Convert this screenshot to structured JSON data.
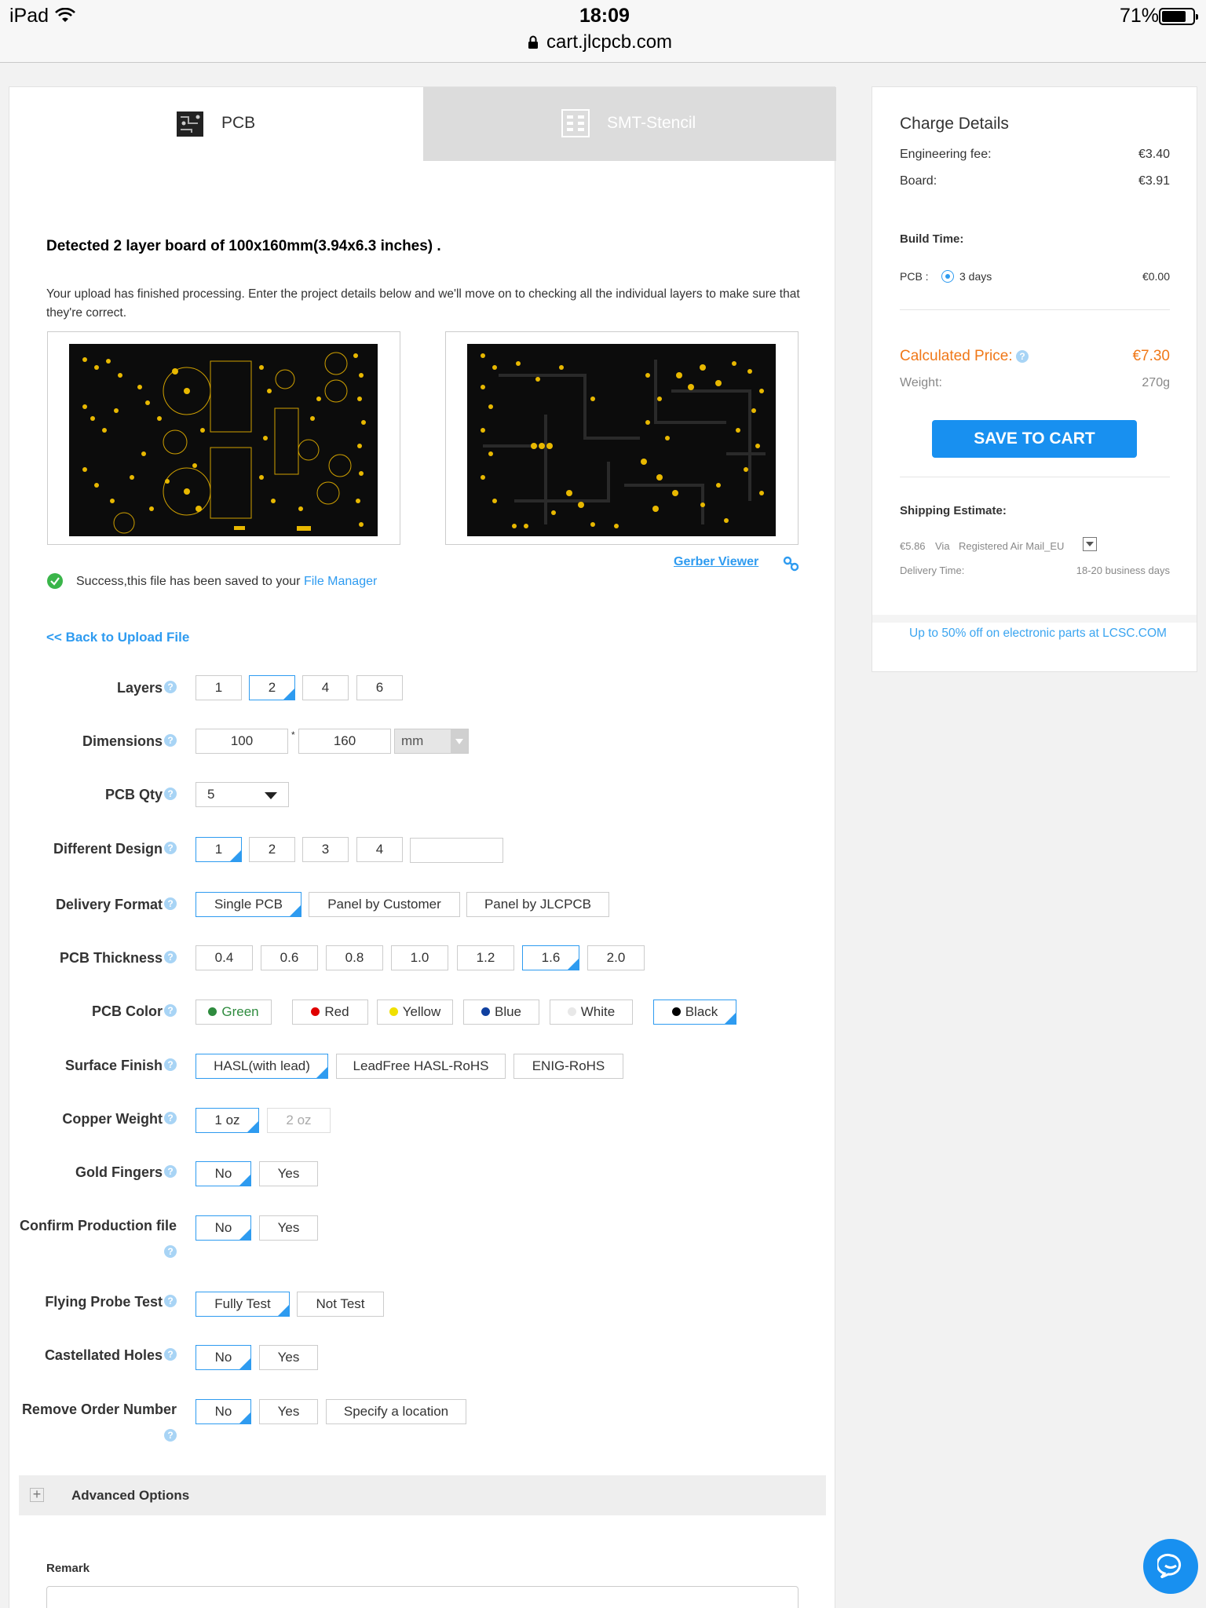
{
  "status": {
    "device": "iPad",
    "time": "18:09",
    "battery": "71%",
    "url": "cart.jlcpcb.com"
  },
  "tabs": [
    {
      "label": "PCB"
    },
    {
      "label": "SMT-Stencil"
    }
  ],
  "detect_title": "Detected 2 layer board of 100x160mm(3.94x6.3 inches) .",
  "detect_text": "Your upload has finished processing. Enter the project details below and we'll move on to checking all the individual layers to make sure that they're correct.",
  "gerber_viewer": "Gerber Viewer",
  "success_text": "Success,this file has been saved to your",
  "file_manager": "File Manager",
  "back_link": "<< Back to Upload File",
  "form": {
    "layers": {
      "label": "Layers",
      "options": [
        "1",
        "2",
        "4",
        "6"
      ],
      "selected": "2"
    },
    "dimensions": {
      "label": "Dimensions",
      "width": "100",
      "sep": "*",
      "height": "160",
      "unit": "mm"
    },
    "qty": {
      "label": "PCB Qty",
      "value": "5"
    },
    "design": {
      "label": "Different Design",
      "options": [
        "1",
        "2",
        "3",
        "4"
      ],
      "selected": "1"
    },
    "delivery": {
      "label": "Delivery Format",
      "options": [
        "Single PCB",
        "Panel by Customer",
        "Panel by JLCPCB"
      ],
      "selected": "Single PCB"
    },
    "thickness": {
      "label": "PCB Thickness",
      "options": [
        "0.4",
        "0.6",
        "0.8",
        "1.0",
        "1.2",
        "1.6",
        "2.0"
      ],
      "selected": "1.6"
    },
    "color": {
      "label": "PCB Color",
      "options": [
        {
          "name": "Green",
          "color": "#2e8b3e"
        },
        {
          "name": "Red",
          "color": "#e00000"
        },
        {
          "name": "Yellow",
          "color": "#f0e000"
        },
        {
          "name": "Blue",
          "color": "#1040a0"
        },
        {
          "name": "White",
          "color": "#e8e8e8"
        },
        {
          "name": "Black",
          "color": "#000000"
        }
      ],
      "selected": "Black"
    },
    "surface": {
      "label": "Surface Finish",
      "options": [
        "HASL(with lead)",
        "LeadFree HASL-RoHS",
        "ENIG-RoHS"
      ],
      "selected": "HASL(with lead)"
    },
    "copper": {
      "label": "Copper Weight",
      "options": [
        "1 oz",
        "2 oz"
      ],
      "selected": "1 oz"
    },
    "gold": {
      "label": "Gold Fingers",
      "options": [
        "No",
        "Yes"
      ],
      "selected": "No"
    },
    "confirm": {
      "label": "Confirm Production file",
      "options": [
        "No",
        "Yes"
      ],
      "selected": "No"
    },
    "probe": {
      "label": "Flying Probe Test",
      "options": [
        "Fully Test",
        "Not Test"
      ],
      "selected": "Fully Test"
    },
    "castellated": {
      "label": "Castellated Holes",
      "options": [
        "No",
        "Yes"
      ],
      "selected": "No"
    },
    "remove": {
      "label": "Remove Order Number",
      "options": [
        "No",
        "Yes",
        "Specify a location"
      ],
      "selected": "No"
    }
  },
  "advanced": "Advanced Options",
  "remark": "Remark",
  "charge": {
    "title": "Charge Details",
    "eng_label": "Engineering fee:",
    "eng_value": "€3.40",
    "board_label": "Board:",
    "board_value": "€3.91",
    "build_label": "Build Time:",
    "pcb_label": "PCB :",
    "pcb_option": "3 days",
    "pcb_value": "€0.00",
    "calc_label": "Calculated Price:",
    "calc_value": "€7.30",
    "weight_label": "Weight:",
    "weight_value": "270g",
    "save_button": "SAVE TO CART",
    "ship_label": "Shipping Estimate:",
    "ship_price": "€5.86",
    "ship_via": "Via",
    "ship_method": "Registered Air Mail_EU",
    "delivery_label": "Delivery Time:",
    "delivery_value": "18-20 business days",
    "promo": "Up to 50% off on electronic parts at LCSC.COM"
  },
  "colors": {
    "accent": "#2e9bf0",
    "price": "#f07818",
    "selected_border": "#2e9bf0"
  }
}
